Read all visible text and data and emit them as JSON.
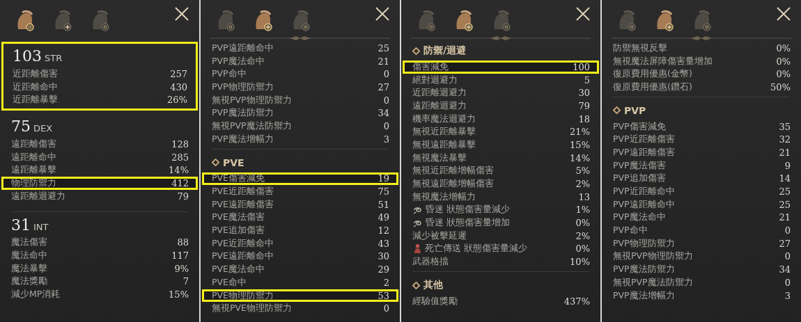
{
  "panels": [
    {
      "tabs": [
        {
          "selected": true
        },
        {
          "selected": false
        },
        {
          "selected": false
        }
      ],
      "ornament": false,
      "blocks": [
        {
          "kind": "attribute",
          "value": "103",
          "name": "STR",
          "highlighted": true,
          "rows": [
            {
              "label": "近距離傷害",
              "value": "257",
              "highlighted": false
            },
            {
              "label": "近距離命中",
              "value": "430",
              "highlighted": false
            },
            {
              "label": "近距離暴擊",
              "value": "26%",
              "highlighted": false
            }
          ]
        },
        {
          "kind": "attribute",
          "value": "75",
          "name": "DEX",
          "highlighted": false,
          "rows": [
            {
              "label": "遠距離傷害",
              "value": "128",
              "highlighted": false
            },
            {
              "label": "遠距離命中",
              "value": "285",
              "highlighted": false
            },
            {
              "label": "遠距離暴擊",
              "value": "14%",
              "highlighted": false
            },
            {
              "label": "物理防禦力",
              "value": "412",
              "highlighted": true
            },
            {
              "label": "遠距離迴避力",
              "value": "79",
              "highlighted": false
            }
          ]
        },
        {
          "kind": "divider"
        },
        {
          "kind": "attribute",
          "value": "31",
          "name": "INT",
          "highlighted": false,
          "rows": [
            {
              "label": "魔法傷害",
              "value": "88",
              "highlighted": false
            },
            {
              "label": "魔法命中",
              "value": "117",
              "highlighted": false
            },
            {
              "label": "魔法暴擊",
              "value": "9%",
              "highlighted": false
            },
            {
              "label": "魔法獎勵",
              "value": "7",
              "highlighted": false
            },
            {
              "label": "減少MP消耗",
              "value": "15%",
              "highlighted": false
            }
          ]
        }
      ]
    },
    {
      "tabs": [
        {
          "selected": false
        },
        {
          "selected": true
        },
        {
          "selected": false
        }
      ],
      "ornament": true,
      "blocks": [
        {
          "kind": "section",
          "rows": [
            {
              "label": "PVP遠距離命中",
              "value": "25",
              "highlighted": false
            },
            {
              "label": "PVP魔法命中",
              "value": "21",
              "highlighted": false
            },
            {
              "label": "PVP命中",
              "value": "0",
              "highlighted": false
            },
            {
              "label": "PVP物理防禦力",
              "value": "27",
              "highlighted": false
            },
            {
              "label": "無視PVP物理防禦力",
              "value": "0",
              "highlighted": false
            },
            {
              "label": "PVP魔法防禦力",
              "value": "34",
              "highlighted": false
            },
            {
              "label": "無視PVP魔法防禦力",
              "value": "0",
              "highlighted": false
            },
            {
              "label": "PVP魔法增幅力",
              "value": "3",
              "highlighted": false
            }
          ]
        },
        {
          "kind": "divider"
        },
        {
          "kind": "section",
          "title": "PVE",
          "rows": [
            {
              "label": "PVE傷害減免",
              "value": "19",
              "highlighted": true
            },
            {
              "label": "PVE近距離傷害",
              "value": "75",
              "highlighted": false
            },
            {
              "label": "PVE遠距離傷害",
              "value": "51",
              "highlighted": false
            },
            {
              "label": "PVE魔法傷害",
              "value": "49",
              "highlighted": false
            },
            {
              "label": "PVE追加傷害",
              "value": "12",
              "highlighted": false
            },
            {
              "label": "PVE近距離命中",
              "value": "43",
              "highlighted": false
            },
            {
              "label": "PVE遠距離命中",
              "value": "30",
              "highlighted": false
            },
            {
              "label": "PVE魔法命中",
              "value": "29",
              "highlighted": false
            },
            {
              "label": "PVE命中",
              "value": "2",
              "highlighted": false
            },
            {
              "label": "PVE物理防禦力",
              "value": "53",
              "highlighted": true
            },
            {
              "label": "無視PVE物理防禦力",
              "value": "0",
              "highlighted": false
            }
          ]
        }
      ]
    },
    {
      "tabs": [
        {
          "selected": false
        },
        {
          "selected": true
        },
        {
          "selected": false
        }
      ],
      "ornament": true,
      "blocks": [
        {
          "kind": "section",
          "title": "防禦/迴避",
          "rows": [
            {
              "label": "傷害減免",
              "value": "100",
              "highlighted": true
            },
            {
              "label": "絕對迴避力",
              "value": "5",
              "highlighted": false
            },
            {
              "label": "近距離迴避力",
              "value": "30",
              "highlighted": false
            },
            {
              "label": "遠距離迴避力",
              "value": "79",
              "highlighted": false
            },
            {
              "label": "機率魔法迴避力",
              "value": "18",
              "highlighted": false
            },
            {
              "label": "無視近距離暴擊",
              "value": "21%",
              "highlighted": false
            },
            {
              "label": "無視遠距離暴擊",
              "value": "15%",
              "highlighted": false
            },
            {
              "label": "無視魔法暴擊",
              "value": "14%",
              "highlighted": false
            },
            {
              "label": "無視近距離增幅傷害",
              "value": "5%",
              "highlighted": false
            },
            {
              "label": "無視遠距離增幅傷害",
              "value": "2%",
              "highlighted": false
            },
            {
              "label": "無視魔法增幅力",
              "value": "13",
              "highlighted": false
            },
            {
              "label": "昏迷 狀態傷害量減少",
              "value": "1%",
              "highlighted": false,
              "kind": "stun"
            },
            {
              "label": "昏迷 狀態傷害量增加",
              "value": "0%",
              "highlighted": false,
              "kind": "stun"
            },
            {
              "label": "減少被擊延遲",
              "value": "2%",
              "highlighted": false
            },
            {
              "label": "死亡傳送 狀態傷害量減少",
              "value": "0%",
              "highlighted": false,
              "kind": "death"
            },
            {
              "label": "武器格擋",
              "value": "10%",
              "highlighted": false
            }
          ]
        },
        {
          "kind": "divider"
        },
        {
          "kind": "section",
          "title": "其他",
          "rows": [
            {
              "label": "經驗值獎勵",
              "value": "437%",
              "highlighted": false
            }
          ]
        }
      ]
    },
    {
      "tabs": [
        {
          "selected": false
        },
        {
          "selected": true
        },
        {
          "selected": false
        }
      ],
      "ornament": true,
      "blocks": [
        {
          "kind": "section",
          "rows": [
            {
              "label": "防禦無視反擊",
              "value": "0%",
              "highlighted": false
            },
            {
              "label": "無視魔法屏障傷害量增加",
              "value": "0%",
              "highlighted": false
            },
            {
              "label": "復原費用優惠(金幣)",
              "value": "0%",
              "highlighted": false
            },
            {
              "label": "復原費用優惠(鑽石)",
              "value": "50%",
              "highlighted": false
            }
          ]
        },
        {
          "kind": "divider"
        },
        {
          "kind": "section",
          "title": "PVP",
          "rows": [
            {
              "label": "PVP傷害減免",
              "value": "35",
              "highlighted": false
            },
            {
              "label": "PVP近距離傷害",
              "value": "32",
              "highlighted": false
            },
            {
              "label": "PVP遠距離傷害",
              "value": "21",
              "highlighted": false
            },
            {
              "label": "PVP魔法傷害",
              "value": "9",
              "highlighted": false
            },
            {
              "label": "PVP追加傷害",
              "value": "14",
              "highlighted": false
            },
            {
              "label": "PVP近距離命中",
              "value": "25",
              "highlighted": false
            },
            {
              "label": "PVP遠距離命中",
              "value": "25",
              "highlighted": false
            },
            {
              "label": "PVP魔法命中",
              "value": "21",
              "highlighted": false
            },
            {
              "label": "PVP命中",
              "value": "0",
              "highlighted": false
            },
            {
              "label": "PVP物理防禦力",
              "value": "27",
              "highlighted": false
            },
            {
              "label": "無視PVP物理防禦力",
              "value": "0",
              "highlighted": false
            },
            {
              "label": "PVP魔法防禦力",
              "value": "34",
              "highlighted": false
            },
            {
              "label": "無視PVP魔法防禦力",
              "value": "0",
              "highlighted": false
            },
            {
              "label": "PVP魔法增幅力",
              "value": "3",
              "highlighted": false
            }
          ]
        }
      ]
    }
  ]
}
